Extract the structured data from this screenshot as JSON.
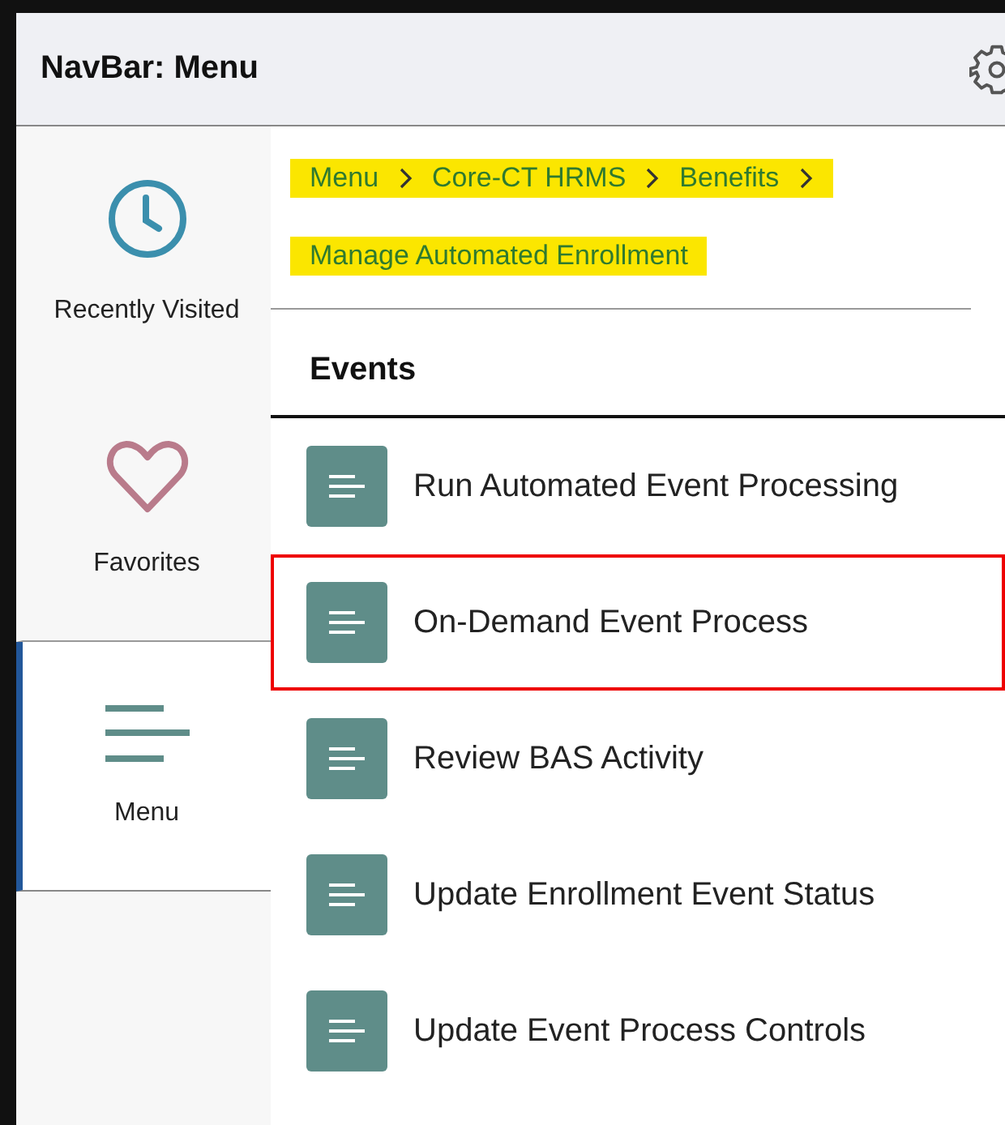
{
  "header": {
    "title": "NavBar: Menu"
  },
  "sidebar": {
    "items": [
      {
        "kind": "clock",
        "label": "Recently Visited",
        "selected": false
      },
      {
        "kind": "heart",
        "label": "Favorites",
        "selected": false
      },
      {
        "kind": "menu",
        "label": "Menu",
        "selected": true
      }
    ]
  },
  "breadcrumb": {
    "highlighted": true,
    "items": [
      "Menu",
      "Core-CT HRMS",
      "Benefits",
      "Manage Automated Enrollment"
    ]
  },
  "section": {
    "title": "Events"
  },
  "items": [
    {
      "label": "Run Automated Event Processing",
      "outlined": false
    },
    {
      "label": "On-Demand Event Process",
      "outlined": true
    },
    {
      "label": "Review BAS Activity",
      "outlined": false
    },
    {
      "label": "Update Enrollment Event Status",
      "outlined": false
    },
    {
      "label": "Update Event Process Controls",
      "outlined": false
    }
  ]
}
